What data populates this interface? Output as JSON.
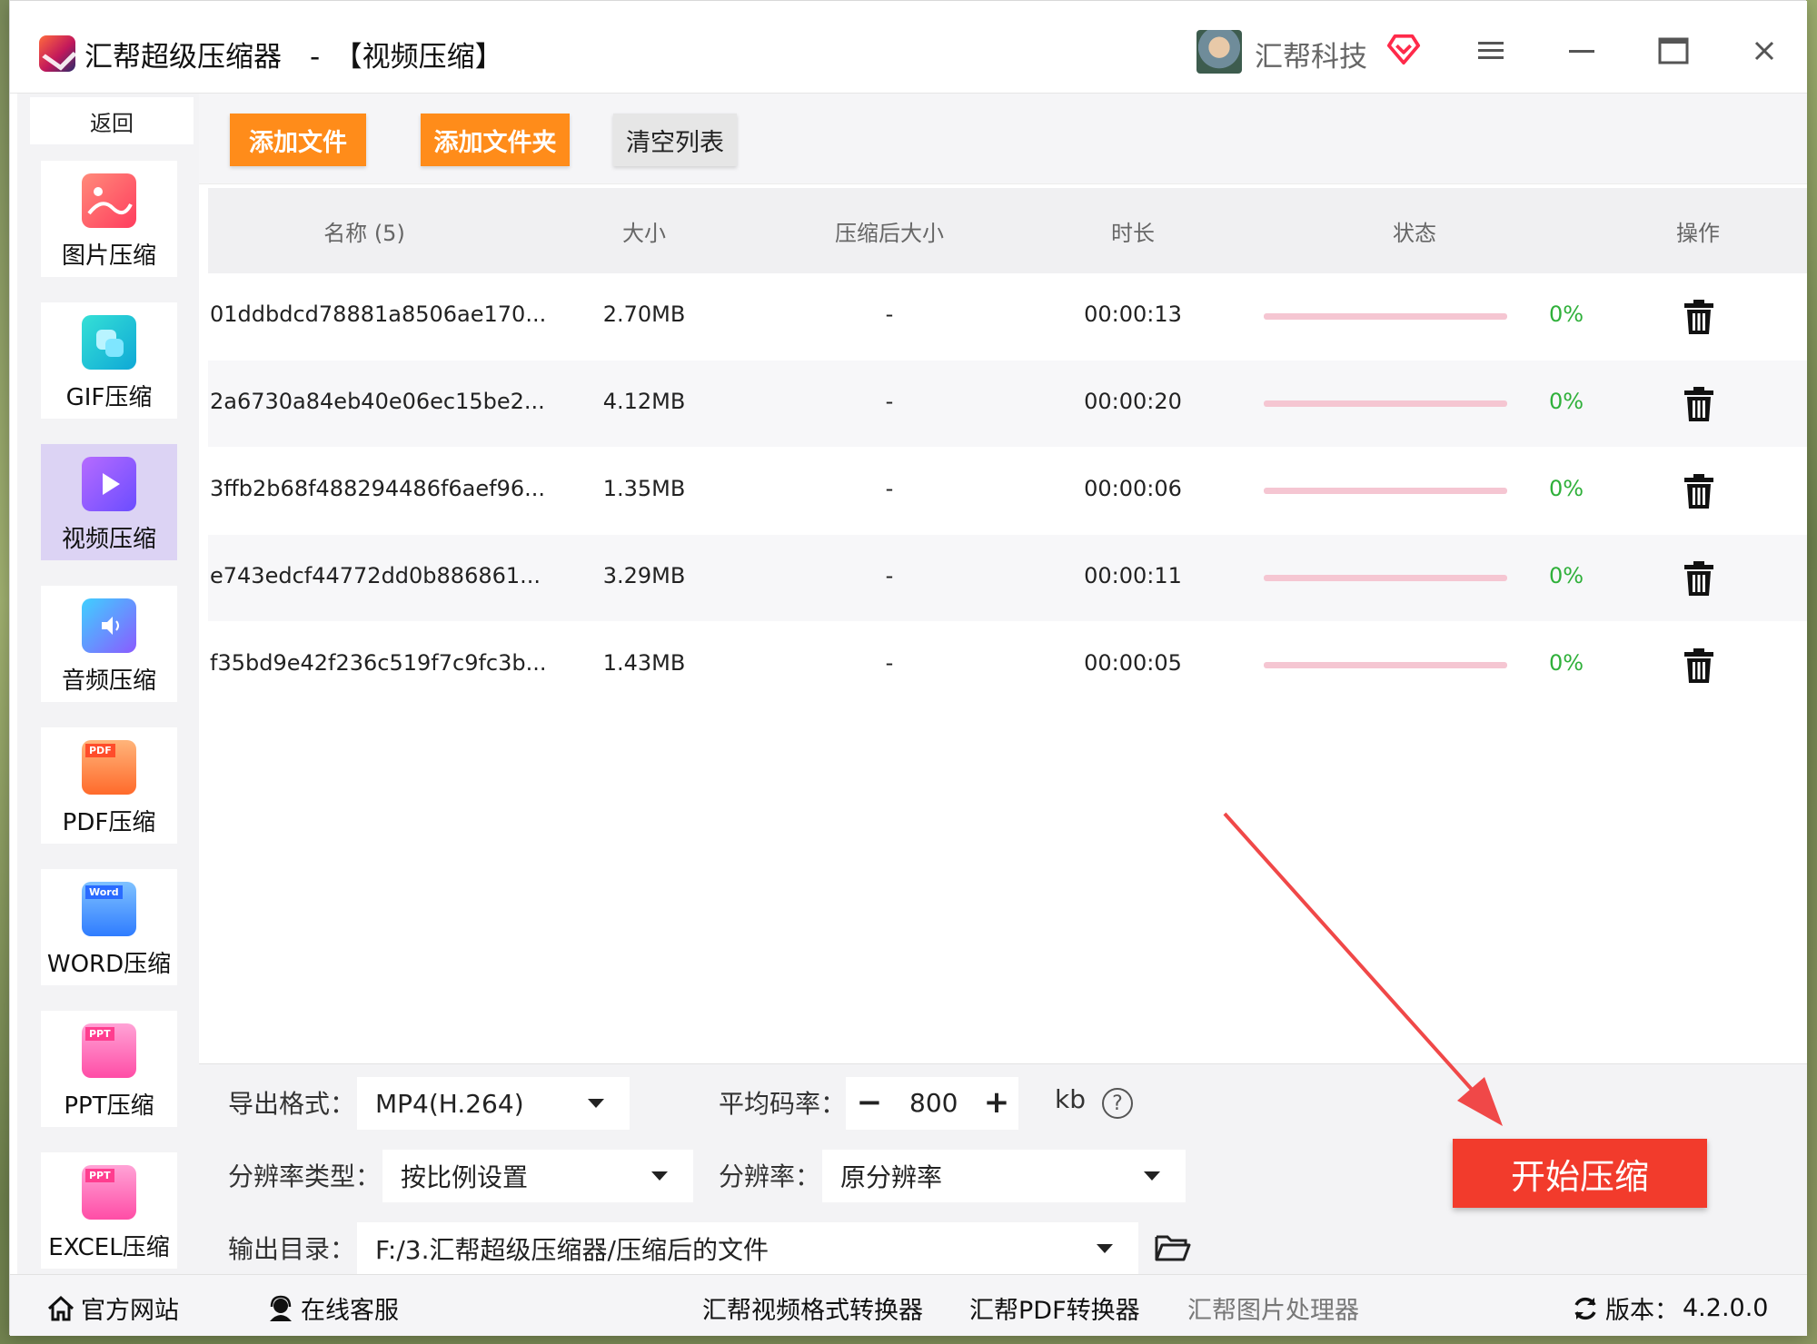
{
  "window": {
    "title": "汇帮超级压缩器　-　【视频压缩】",
    "user_name": "汇帮科技",
    "menu_icon": "hamburger-icon",
    "minimize_icon": "minimize-icon",
    "maximize_icon": "maximize-icon",
    "close_icon": "close-icon"
  },
  "sidebar": {
    "back_label": "返回",
    "items": [
      {
        "label": "图片压缩",
        "icon": "image-icon",
        "color": "#ff5a6e"
      },
      {
        "label": "GIF压缩",
        "icon": "gif-icon",
        "color": "#16c2d6"
      },
      {
        "label": "视频压缩",
        "icon": "video-icon",
        "color": "#7c4dff",
        "active": true
      },
      {
        "label": "音频压缩",
        "icon": "audio-icon",
        "color": "#4da3ff"
      },
      {
        "label": "PDF压缩",
        "icon": "pdf-icon",
        "color": "#ff7a3d",
        "badge": "PDF"
      },
      {
        "label": "WORD压缩",
        "icon": "word-icon",
        "color": "#3b8cff",
        "badge": "Word"
      },
      {
        "label": "PPT压缩",
        "icon": "ppt-icon",
        "color": "#ff5fa8",
        "badge": "PPT"
      },
      {
        "label": "EXCEL压缩",
        "icon": "excel-icon",
        "color": "#ff5fa8",
        "badge": "PPT"
      }
    ]
  },
  "toolbar": {
    "add_file": "添加文件",
    "add_folder": "添加文件夹",
    "clear_list": "清空列表"
  },
  "table": {
    "headers": {
      "name": "名称 (5)",
      "size": "大小",
      "compressed_size": "压缩后大小",
      "duration": "时长",
      "status": "状态",
      "action": "操作"
    },
    "rows": [
      {
        "name": "01ddbdcd78881a8506ae170...",
        "size": "2.70MB",
        "compressed": "-",
        "duration": "00:00:13",
        "progress": 0,
        "percent": "0%"
      },
      {
        "name": "2a6730a84eb40e06ec15be2...",
        "size": "4.12MB",
        "compressed": "-",
        "duration": "00:00:20",
        "progress": 0,
        "percent": "0%"
      },
      {
        "name": "3ffb2b68f488294486f6aef96...",
        "size": "1.35MB",
        "compressed": "-",
        "duration": "00:00:06",
        "progress": 0,
        "percent": "0%"
      },
      {
        "name": "e743edcf44772dd0b886861...",
        "size": "3.29MB",
        "compressed": "-",
        "duration": "00:00:11",
        "progress": 0,
        "percent": "0%"
      },
      {
        "name": "f35bd9e42f236c519f7c9fc3b...",
        "size": "1.43MB",
        "compressed": "-",
        "duration": "00:00:05",
        "progress": 0,
        "percent": "0%"
      }
    ]
  },
  "settings": {
    "format_label": "导出格式：",
    "format_value": "MP4(H.264)",
    "bitrate_label": "平均码率：",
    "bitrate_value": "800",
    "bitrate_unit": "kb",
    "resolution_type_label": "分辨率类型：",
    "resolution_type_value": "按比例设置",
    "resolution_label": "分辨率：",
    "resolution_value": "原分辨率",
    "output_label": "输出目录：",
    "output_value": "F:/3.汇帮超级压缩器/压缩后的文件",
    "start_button": "开始压缩"
  },
  "footer": {
    "website": "官方网站",
    "support": "在线客服",
    "video_converter": "汇帮视频格式转换器",
    "pdf_converter": "汇帮PDF转换器",
    "image_processor": "汇帮图片处理器",
    "version_label": "版本：",
    "version_value": "4.2.0.0"
  },
  "colors": {
    "accent_orange": "#ff8c1a",
    "start_red": "#f23b2c",
    "progress_pink": "#f5c6d2",
    "percent_green": "#2fb03a",
    "active_nav": "#dcd3f4"
  }
}
